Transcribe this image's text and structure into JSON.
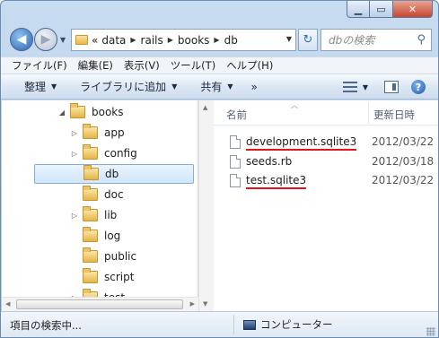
{
  "navigation": {
    "breadcrumb": [
      "«",
      "data",
      "rails",
      "books",
      "db"
    ],
    "search_placeholder": "dbの検索"
  },
  "menubar": [
    "ファイル(F)",
    "編集(E)",
    "表示(V)",
    "ツール(T)",
    "ヘルプ(H)"
  ],
  "toolbar": {
    "organize": "整理",
    "library": "ライブラリに追加",
    "share": "共有",
    "more": "»"
  },
  "tree": {
    "root": "books",
    "children": [
      {
        "label": "app",
        "expandable": true
      },
      {
        "label": "config",
        "expandable": true
      },
      {
        "label": "db",
        "expandable": false,
        "selected": true
      },
      {
        "label": "doc",
        "expandable": false
      },
      {
        "label": "lib",
        "expandable": true
      },
      {
        "label": "log",
        "expandable": false
      },
      {
        "label": "public",
        "expandable": false
      },
      {
        "label": "script",
        "expandable": false
      },
      {
        "label": "test",
        "expandable": true
      }
    ]
  },
  "files": {
    "col_name": "名前",
    "col_date": "更新日時",
    "rows": [
      {
        "name": "development.sqlite3",
        "date": "2012/03/22",
        "underlined": true
      },
      {
        "name": "seeds.rb",
        "date": "2012/03/18",
        "underlined": false
      },
      {
        "name": "test.sqlite3",
        "date": "2012/03/22",
        "underlined": true
      }
    ]
  },
  "status": {
    "left": "項目の検索中...",
    "right": "コンピューター"
  },
  "colors": {
    "underline": "#e0141e",
    "selection": "#cfe6fb"
  }
}
